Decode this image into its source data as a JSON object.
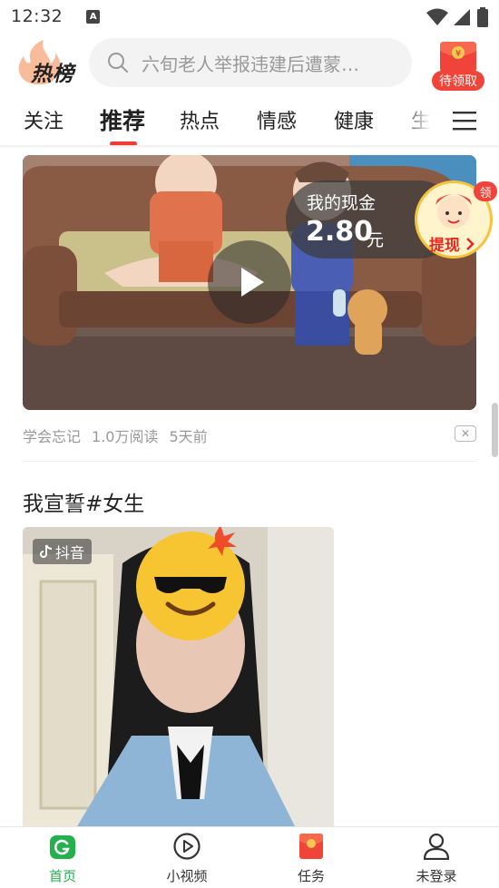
{
  "status_bar": {
    "time": "12:32",
    "a_badge": "A"
  },
  "header": {
    "logo_text": "热榜",
    "search_placeholder": "六旬老人举报违建后遭蒙…",
    "redpacket_label": "待领取",
    "redpacket_symbol": "¥"
  },
  "tabs": {
    "items": [
      "关注",
      "推荐",
      "热点",
      "情感",
      "健康",
      "生"
    ],
    "active_index": 1,
    "accent_color": "#f03d33"
  },
  "feed": {
    "video_card": {
      "source": "学会忘记",
      "reads": "1.0万阅读",
      "time": "5天前",
      "dislike_symbol": "✕"
    },
    "post": {
      "title": "我宣誓#女生",
      "badge_text": "抖音"
    }
  },
  "cash_float": {
    "title": "我的现金",
    "amount": "2.80",
    "unit": "元",
    "withdraw_label": "提现",
    "claim_badge": "领"
  },
  "bottom_nav": {
    "items": [
      {
        "label": "首页",
        "icon": "home-icon",
        "active": true
      },
      {
        "label": "小视频",
        "icon": "play-circle-icon",
        "active": false
      },
      {
        "label": "任务",
        "icon": "task-redpacket-icon",
        "active": false
      },
      {
        "label": "未登录",
        "icon": "user-icon",
        "active": false
      }
    ],
    "active_color": "#22b14c"
  }
}
